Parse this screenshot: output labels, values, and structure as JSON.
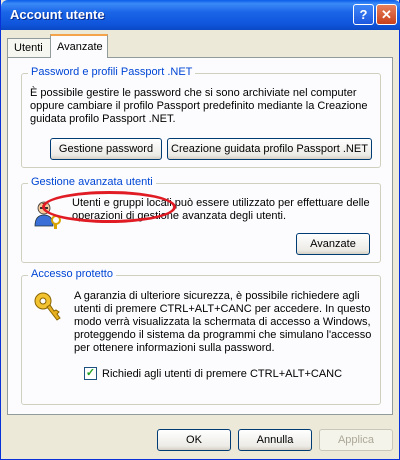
{
  "window": {
    "title": "Account utente"
  },
  "titlebar": {
    "help_label": "?",
    "close_label": "✕"
  },
  "tabs": [
    {
      "label": "Utenti"
    },
    {
      "label": "Avanzate"
    }
  ],
  "passport_group": {
    "title": "Password e profili Passport .NET",
    "description": "È possibile gestire le password che si sono archiviate nel computer oppure cambiare il profilo Passport predefinito mediante la Creazione guidata profilo Passport .NET.",
    "manage_button": "Gestione password",
    "wizard_button": "Creazione guidata profilo Passport .NET"
  },
  "advanced_group": {
    "title": "Gestione avanzata utenti",
    "description": "Utenti e gruppi locali può essere utilizzato per effettuare delle operazioni di gestione avanzata degli utenti.",
    "advanced_button": "Avanzate"
  },
  "secure_group": {
    "title": "Accesso protetto",
    "description": "A garanzia di ulteriore sicurezza, è possibile richiedere agli utenti di premere CTRL+ALT+CANC per accedere. In questo modo verrà visualizzata la schermata di accesso a Windows, proteggendo il sistema da programmi che simulano l'accesso per ottenere informazioni sulla password.",
    "checkbox_label": "Richiedi agli utenti di premere CTRL+ALT+CANC",
    "checkbox_checked": true
  },
  "footer": {
    "ok": "OK",
    "cancel": "Annulla",
    "apply": "Applica"
  }
}
